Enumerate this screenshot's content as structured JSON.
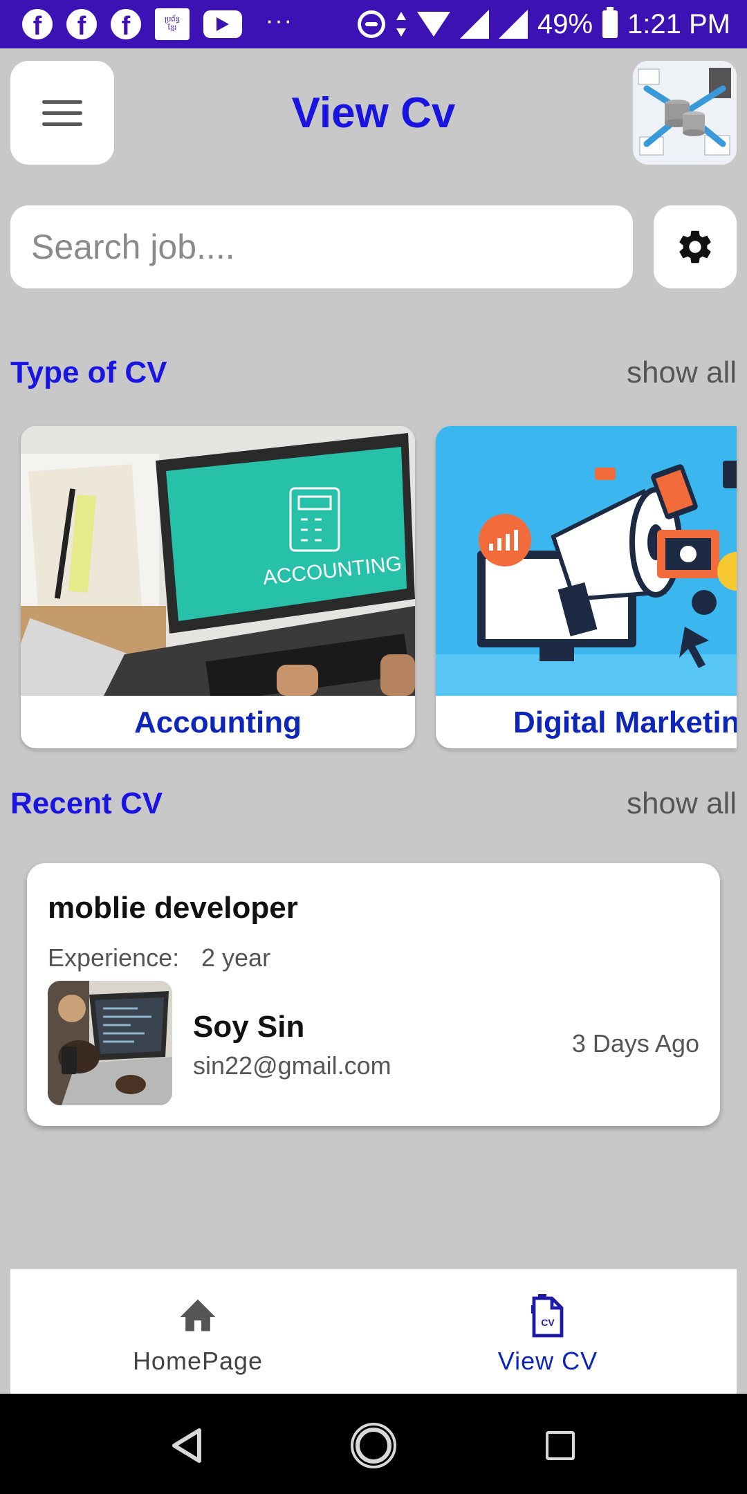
{
  "status_bar": {
    "icons": [
      "facebook-icon",
      "facebook-icon",
      "facebook-icon",
      "news-app-icon",
      "youtube-icon",
      "more-notifications-icon"
    ],
    "news_icon_text_1": "ប្រព័ន្ធ",
    "news_icon_text_2": "ខ្មែរ",
    "right_icons": [
      "do-not-disturb-icon",
      "data-arrows-icon",
      "wifi-icon",
      "signal-icon",
      "signal-icon"
    ],
    "battery": "49%",
    "time": "1:21 PM"
  },
  "header": {
    "title": "View Cv",
    "menu_icon": "hamburger-menu-icon",
    "avatar": "profile-avatar-image"
  },
  "search": {
    "placeholder": "Search job....",
    "value": "",
    "settings_icon": "gear-icon"
  },
  "type_section": {
    "title": "Type of CV",
    "show_all": "show all",
    "items": [
      {
        "label": "Accounting",
        "image": "accounting-laptop-image",
        "screen_text": "ACCOUNTING"
      },
      {
        "label": "Digital Marketing",
        "image": "digital-marketing-megaphone-image"
      }
    ]
  },
  "recent_section": {
    "title": "Recent CV",
    "show_all": "show all",
    "items": [
      {
        "job_title": "moblie developer",
        "experience_label": "Experience:",
        "experience_value": "2 year",
        "name": "Soy Sin",
        "email": "sin22@gmail.com",
        "time": "3 Days Ago"
      }
    ]
  },
  "bottom_nav": {
    "items": [
      {
        "label": "HomePage",
        "icon": "home-icon",
        "active": false
      },
      {
        "label": "View CV",
        "icon": "cv-document-icon",
        "active": true
      }
    ]
  },
  "colors": {
    "status_bar": "#3d12b4",
    "accent": "#1a14e0",
    "active_nav": "#0d25b8",
    "background": "#c8c8c8"
  }
}
